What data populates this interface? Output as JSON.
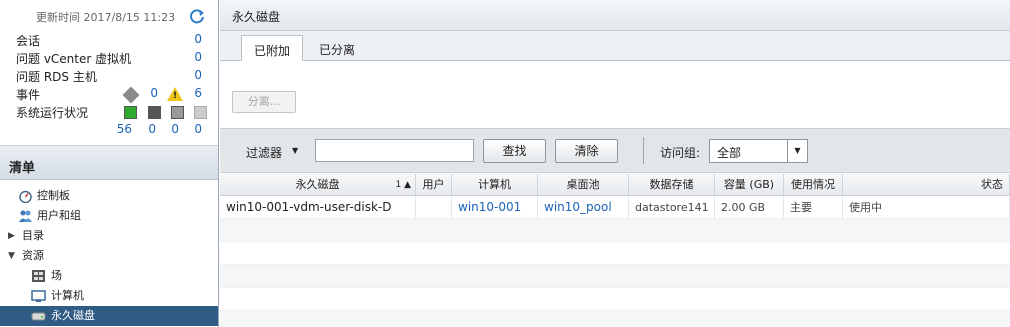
{
  "sidebar": {
    "update_time": "更新时间 2017/8/15 11:23",
    "stats": [
      {
        "label": "会话",
        "value": "0"
      },
      {
        "label": "问题 vCenter 虚拟机",
        "value": "0"
      },
      {
        "label": "问题 RDS 主机",
        "value": "0"
      }
    ],
    "events": {
      "label": "事件",
      "info_count": "0",
      "warning_count": "6"
    },
    "health": {
      "label": "系统运行状况",
      "values": [
        "56",
        "0",
        "0",
        "0"
      ],
      "colors": [
        "#2eaa2e",
        "#555555",
        "#9a9a9a",
        "#cccccc"
      ]
    },
    "inventory_title": "清单",
    "tree": [
      {
        "label": "控制板",
        "icon": "dashboard-icon"
      },
      {
        "label": "用户和组",
        "icon": "users-icon"
      },
      {
        "label": "目录",
        "expander": "▶"
      },
      {
        "label": "资源",
        "expander": "▼"
      },
      {
        "label": "场",
        "icon": "farm-icon"
      },
      {
        "label": "计算机",
        "icon": "machine-icon"
      },
      {
        "label": "永久磁盘",
        "icon": "disk-icon",
        "selected": true
      }
    ]
  },
  "main": {
    "title": "永久磁盘",
    "tabs": [
      "已附加",
      "已分离"
    ],
    "active_tab": "已附加",
    "detach_button": "分离...",
    "filter": {
      "label": "过滤器",
      "input_value": "",
      "find": "查找",
      "clear": "清除",
      "group_label": "访问组:",
      "group_value": "全部"
    },
    "columns": [
      {
        "label": "永久磁盘",
        "sort": "1 ▲"
      },
      {
        "label": "用户"
      },
      {
        "label": "计算机"
      },
      {
        "label": "桌面池"
      },
      {
        "label": "数据存储"
      },
      {
        "label": "容量 (GB)"
      },
      {
        "label": "使用情况"
      },
      {
        "label": "状态"
      }
    ],
    "rows": [
      [
        "win10-001-vdm-user-disk-D",
        "",
        "win10-001",
        "win10_pool",
        "datastore141",
        "2.00 GB",
        "主要",
        "使用中"
      ]
    ]
  }
}
